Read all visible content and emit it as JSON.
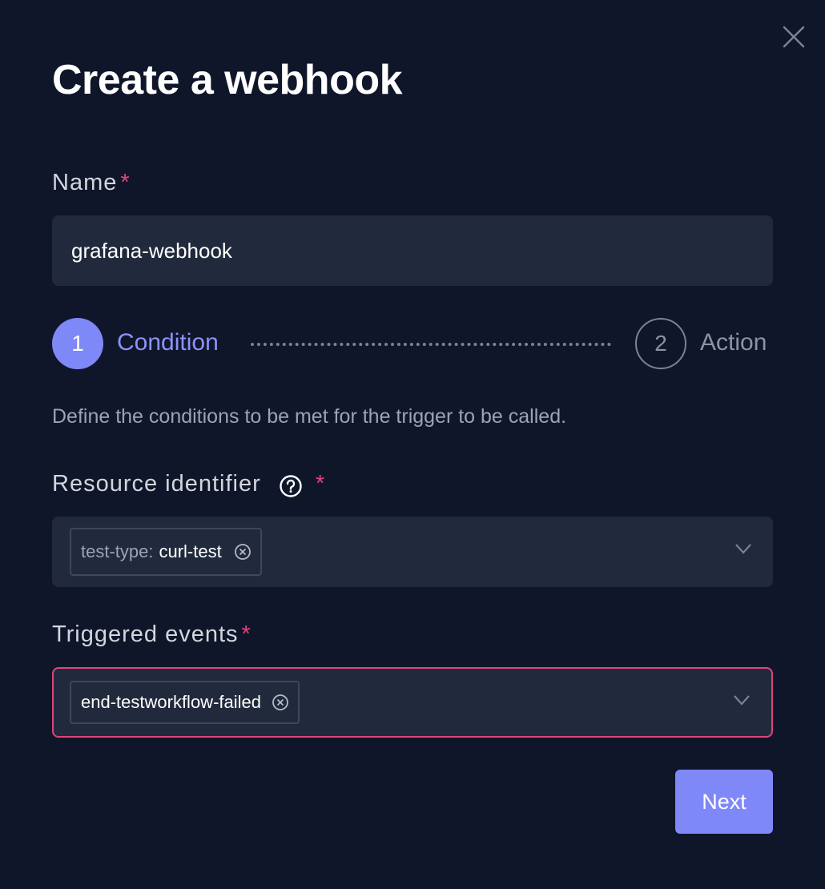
{
  "dialog": {
    "title": "Create a webhook"
  },
  "name_field": {
    "label": "Name",
    "required_mark": "*",
    "value": "grafana-webhook"
  },
  "stepper": {
    "steps": [
      {
        "number": "1",
        "label": "Condition",
        "state": "active"
      },
      {
        "number": "2",
        "label": "Action",
        "state": "inactive"
      }
    ]
  },
  "description": "Define the conditions to be met for the trigger to be called.",
  "resource_identifier": {
    "label": "Resource identifier",
    "required_mark": "*",
    "help_icon": "question-circle-icon",
    "chips": [
      {
        "key": "test-type:",
        "value": "curl-test"
      }
    ]
  },
  "triggered_events": {
    "label": "Triggered events",
    "required_mark": "*",
    "chips": [
      {
        "value": "end-testworkflow-failed"
      }
    ]
  },
  "footer": {
    "next_label": "Next"
  },
  "colors": {
    "background": "#10162a",
    "input_bg": "#212a3c",
    "accent": "#7e88f6",
    "required": "#e0447a",
    "muted": "#9ba3b4"
  }
}
